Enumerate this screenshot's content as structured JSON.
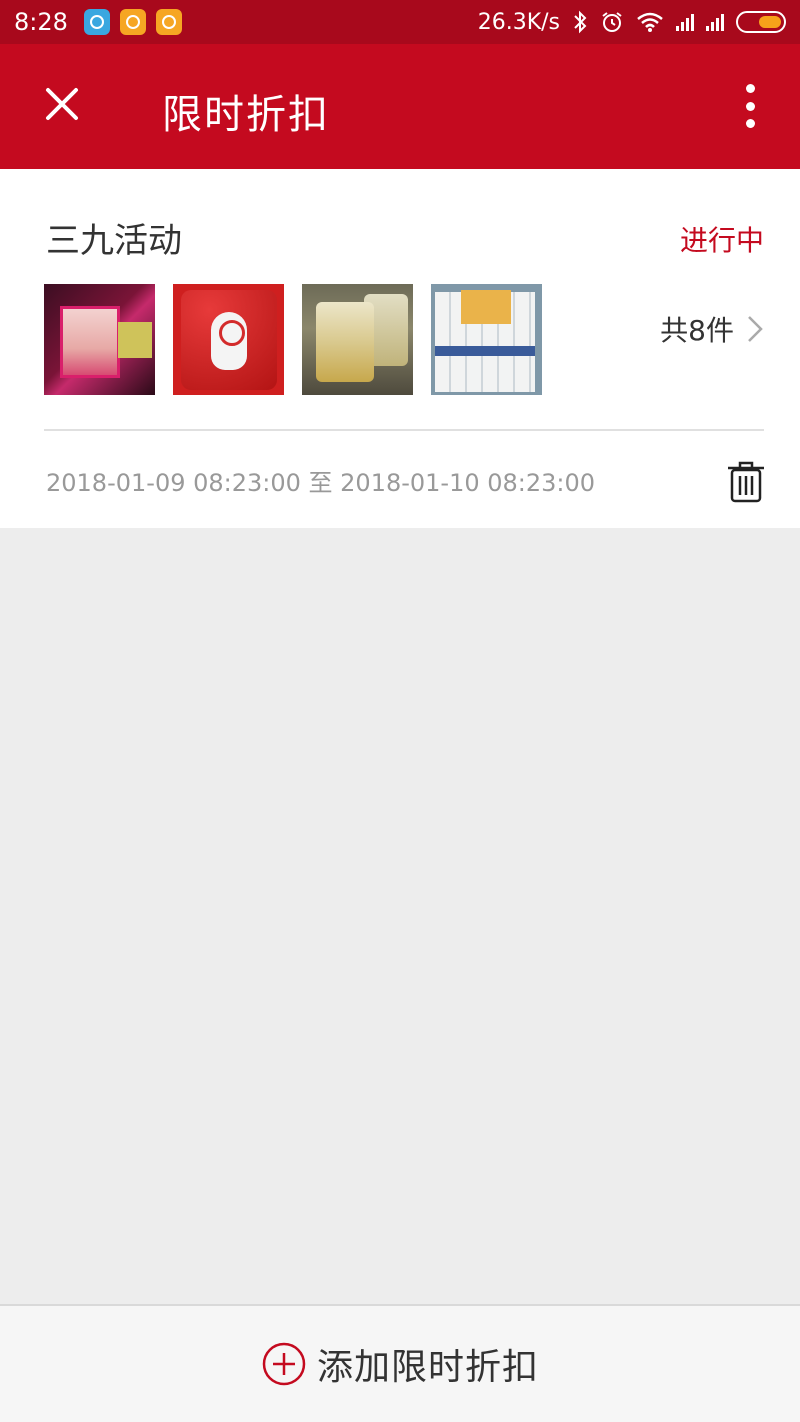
{
  "status_bar": {
    "time": "8:28",
    "network_speed": "26.3K/s"
  },
  "header": {
    "title": "限时折扣",
    "close_icon": "close-icon",
    "more_icon": "more-vertical-icon"
  },
  "activity": {
    "name": "三九活动",
    "status": "进行中",
    "item_count_label": "共8件",
    "date_range": "2018-01-09 08:23:00 至 2018-01-10 08:23:00"
  },
  "bottom": {
    "add_label": "添加限时折扣"
  },
  "colors": {
    "header_red": "#c40a1f",
    "status_red": "#c40a1f",
    "background": "#ededed"
  }
}
